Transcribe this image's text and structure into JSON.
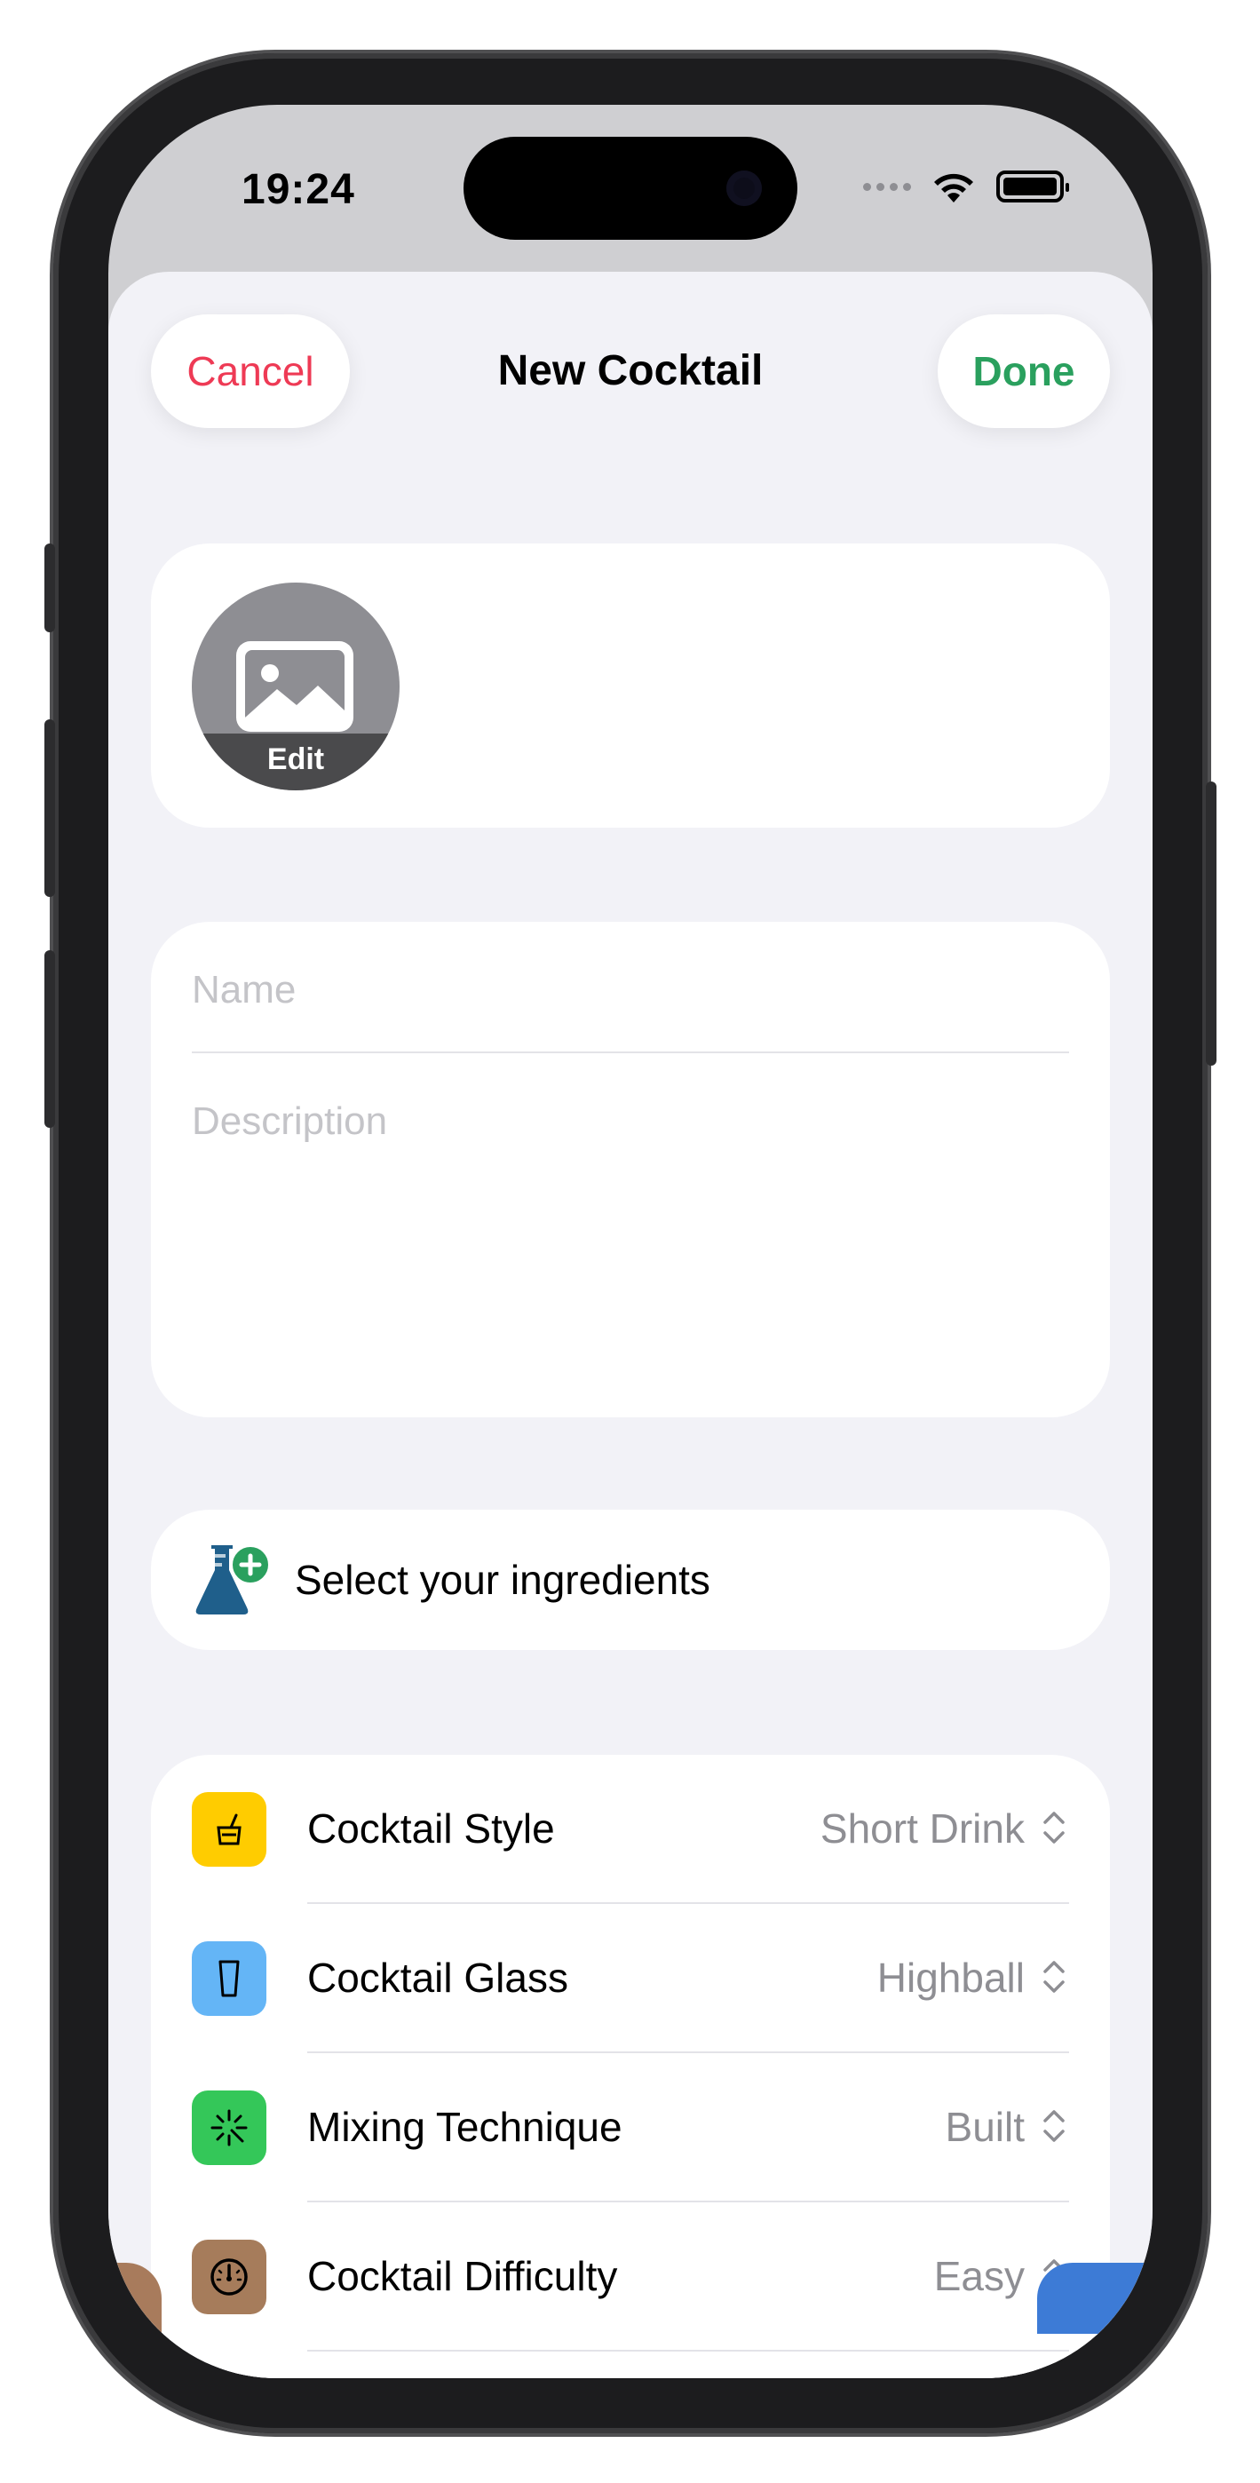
{
  "status_bar": {
    "time": "19:24"
  },
  "nav": {
    "cancel_label": "Cancel",
    "title": "New Cocktail",
    "done_label": "Done"
  },
  "photo": {
    "edit_label": "Edit"
  },
  "form": {
    "name_placeholder": "Name",
    "description_placeholder": "Description"
  },
  "ingredients": {
    "label": "Select your ingredients"
  },
  "options": [
    {
      "label": "Cocktail Style",
      "value": "Short Drink",
      "icon": "short-drink-icon",
      "color": "#ffcc00"
    },
    {
      "label": "Cocktail Glass",
      "value": "Highball",
      "icon": "highball-glass-icon",
      "color": "#64b5f6"
    },
    {
      "label": "Mixing Technique",
      "value": "Built",
      "icon": "sparkle-icon",
      "color": "#34c759"
    },
    {
      "label": "Cocktail Difficulty",
      "value": "Easy",
      "icon": "gauge-icon",
      "color": "#a67c5b"
    }
  ],
  "colors": {
    "cancel": "#ee3a55",
    "done": "#2aa05e",
    "background": "#f2f2f7"
  }
}
